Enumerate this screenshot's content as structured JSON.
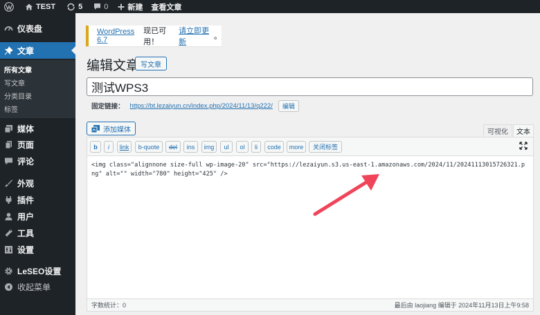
{
  "admin_bar": {
    "site_name": "TEST",
    "updates_count": "5",
    "comments_count": "0",
    "new_label": "新建",
    "view_post_label": "查看文章"
  },
  "sidebar": {
    "dashboard": "仪表盘",
    "posts": "文章",
    "posts_submenu": [
      "所有文章",
      "写文章",
      "分类目录",
      "标签"
    ],
    "media": "媒体",
    "pages": "页面",
    "comments": "评论",
    "appearance": "外观",
    "plugins": "插件",
    "users": "用户",
    "tools": "工具",
    "settings": "设置",
    "leseo": "LeSEO设置",
    "collapse": "收起菜单",
    "accent": "#2271b1"
  },
  "notice": {
    "link_text": "WordPress 6.7",
    "middle_text": " 现已可用！",
    "update_link": "请立即更新",
    "end_text": "。",
    "border_color": "#dba617"
  },
  "page": {
    "title": "编辑文章",
    "add_new_label": "写文章"
  },
  "post": {
    "title": "测试WPS3",
    "permalink_label": "固定链接：",
    "permalink_base": "https://bt.lezaiyun.cn/index.php/2024/11/13/",
    "permalink_slug": "q222",
    "permalink_end": "/",
    "permalink_edit": "编辑"
  },
  "editor": {
    "add_media_label": "添加媒体",
    "tab_visual": "可视化",
    "tab_text": "文本",
    "quicktags": [
      "b",
      "i",
      "link",
      "b-quote",
      "del",
      "ins",
      "img",
      "ul",
      "ol",
      "li",
      "code",
      "more",
      "关闭标签"
    ],
    "content": "<img class=\"alignnone size-full wp-image-20\" src=\"https://lezaiyun.s3.us-east-1.amazonaws.com/2024/11/20241113015726321.png\" alt=\"\" width=\"780\" height=\"425\" />",
    "word_count": "字数统计：0",
    "last_edited": "最后由 laojiang 编辑于 2024年11月13日上午9:58"
  },
  "annotation": {
    "arrow_color": "#f0445a",
    "icon": "pointer-arrow"
  }
}
